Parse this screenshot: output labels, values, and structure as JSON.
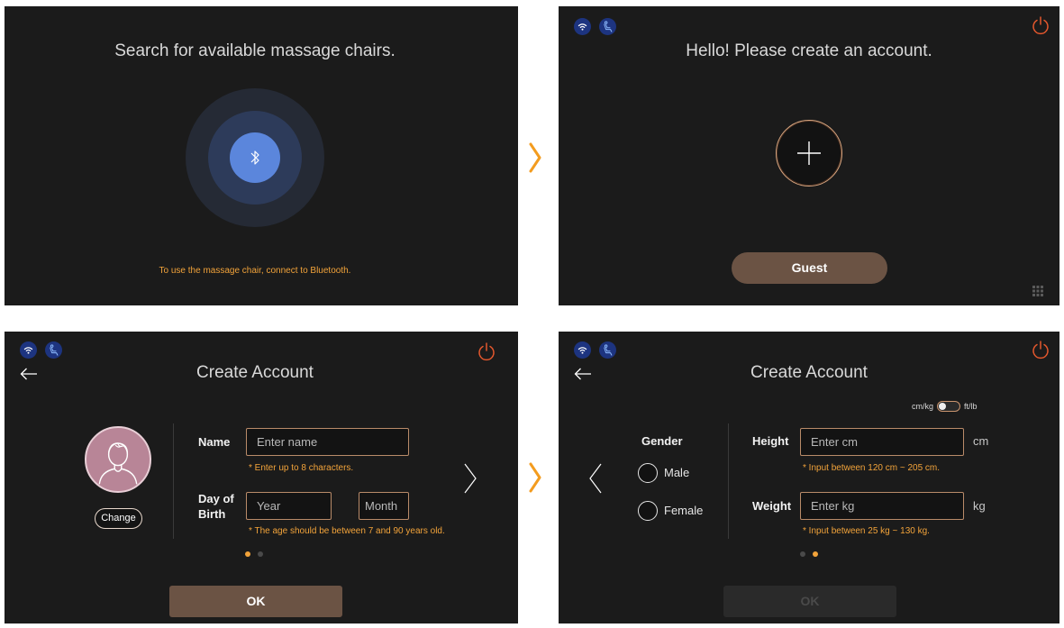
{
  "colors": {
    "panel_bg": "#1b1b1b",
    "accent_orange": "#f2a33a",
    "power_red": "#e3572d",
    "button_brown": "#6b5344",
    "input_border": "#b98b69",
    "ring_outer": "#252a35",
    "ring_middle": "#2d3b5a",
    "ring_inner": "#5b86dc",
    "avatar_fill": "#b88597",
    "flow_arrow": "#f39c1f",
    "status_icon_bg": "#1d3480"
  },
  "flow_arrow_icon": "chevron-right-icon",
  "search_screen": {
    "title": "Search for available massage chairs.",
    "center_icon": "bluetooth-icon",
    "hint": "To use the massage chair, connect to Bluetooth."
  },
  "welcome_screen": {
    "status_icons": [
      "wifi-icon",
      "massage-chair-icon"
    ],
    "power_icon": "power-icon",
    "title": "Hello! Please create an account.",
    "add_account_icon": "plus-icon",
    "guest_label": "Guest",
    "menu_icon": "grid-icon"
  },
  "create_account_step1": {
    "status_icons": [
      "wifi-icon",
      "massage-chair-icon"
    ],
    "power_icon": "power-icon",
    "back_icon": "back-arrow-icon",
    "title": "Create Account",
    "avatar_icon": "person-icon",
    "change_label": "Change",
    "name": {
      "label": "Name",
      "placeholder": "Enter name",
      "hint": "* Enter up to 8 characters."
    },
    "birth": {
      "label": "Day of Birth",
      "year_placeholder": "Year",
      "month_placeholder": "Month",
      "hint": "* The age should be between 7 and 90 years old."
    },
    "next_icon": "chevron-right-icon",
    "pagination": {
      "current": 1,
      "total": 2
    },
    "ok_label": "OK",
    "ok_enabled": true
  },
  "create_account_step2": {
    "status_icons": [
      "wifi-icon",
      "massage-chair-icon"
    ],
    "power_icon": "power-icon",
    "back_icon": "back-arrow-icon",
    "title": "Create Account",
    "unit_toggle": {
      "left_label": "cm/kg",
      "right_label": "ft/lb",
      "metric_selected": true
    },
    "prev_icon": "chevron-left-icon",
    "gender": {
      "label": "Gender",
      "options": [
        "Male",
        "Female"
      ],
      "selected_index": null
    },
    "height": {
      "label": "Height",
      "placeholder": "Enter cm",
      "unit": "cm",
      "hint": "* Input between 120 cm ~ 205 cm."
    },
    "weight": {
      "label": "Weight",
      "placeholder": "Enter kg",
      "unit": "kg",
      "hint": "* Input between 25 kg ~ 130 kg."
    },
    "pagination": {
      "current": 2,
      "total": 2
    },
    "ok_label": "OK",
    "ok_enabled": false
  }
}
